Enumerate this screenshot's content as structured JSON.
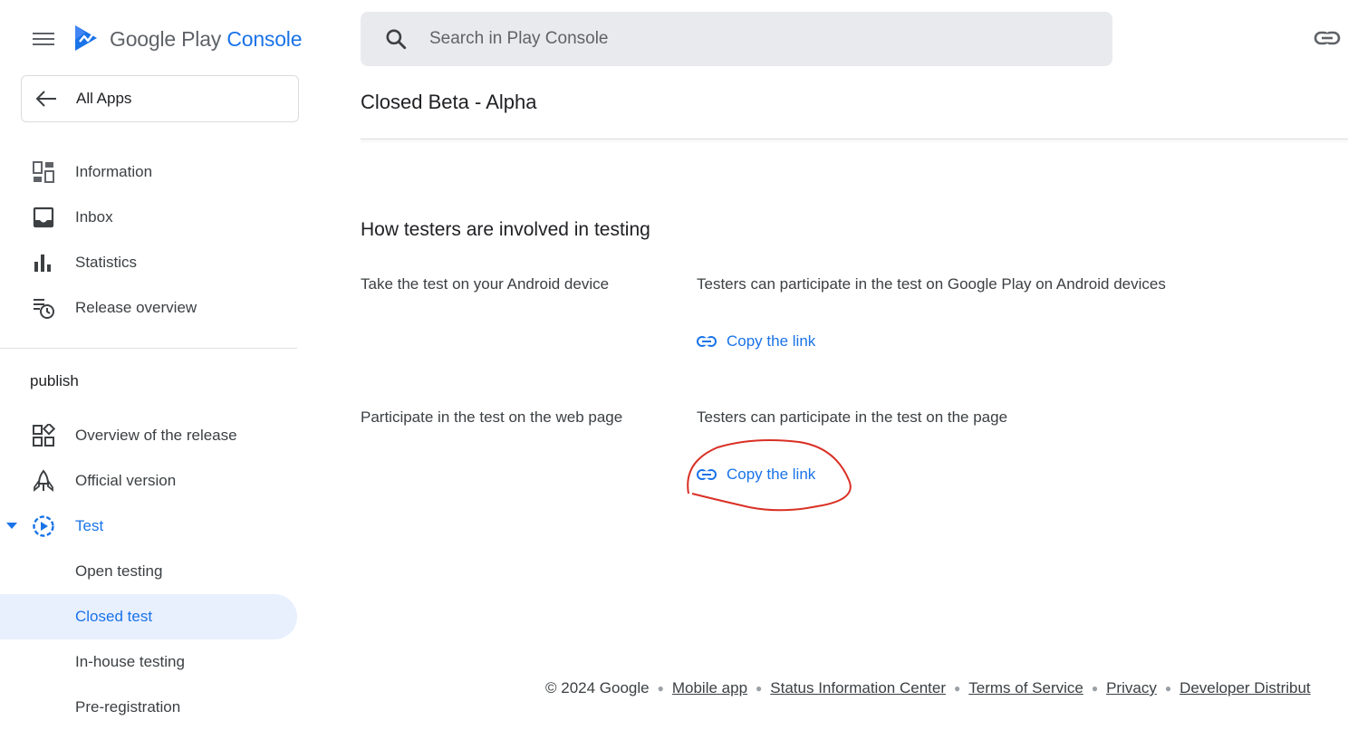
{
  "header": {
    "brand_main": "Google Play",
    "brand_accent": "Console",
    "search_placeholder": "Search in Play Console"
  },
  "sidebar": {
    "back_label": "All Apps",
    "top_items": [
      {
        "label": "Information",
        "icon": "dashboard-icon"
      },
      {
        "label": "Inbox",
        "icon": "inbox-icon"
      },
      {
        "label": "Statistics",
        "icon": "bar-chart-icon"
      },
      {
        "label": "Release overview",
        "icon": "release-overview-icon"
      }
    ],
    "section_label": "publish",
    "publish_items": [
      {
        "label": "Overview of the release",
        "icon": "widgets-icon"
      },
      {
        "label": "Official version",
        "icon": "rocket-icon"
      },
      {
        "label": "Test",
        "icon": "play-circle-icon",
        "expanded": true
      },
      {
        "label": "Open testing"
      },
      {
        "label": "Closed test",
        "selected": true
      },
      {
        "label": "In-house testing"
      },
      {
        "label": "Pre-registration"
      }
    ]
  },
  "main": {
    "page_title": "Closed Beta - Alpha",
    "section_title": "How testers are involved in testing",
    "rows": [
      {
        "label": "Take the test on your Android device",
        "description": "Testers can participate in the test on Google Play on Android devices",
        "link_label": "Copy the link"
      },
      {
        "label": "Participate in the test on the web page",
        "description": "Testers can participate in the test on the page",
        "link_label": "Copy the link"
      }
    ]
  },
  "footer": {
    "copyright": "© 2024 Google",
    "links": [
      "Mobile app",
      "Status Information Center",
      "Terms of Service",
      "Privacy",
      "Developer Distribut"
    ]
  },
  "colors": {
    "accent": "#1a73e8",
    "selected_bg": "#e8f0fe",
    "annotation": "#d93025"
  }
}
